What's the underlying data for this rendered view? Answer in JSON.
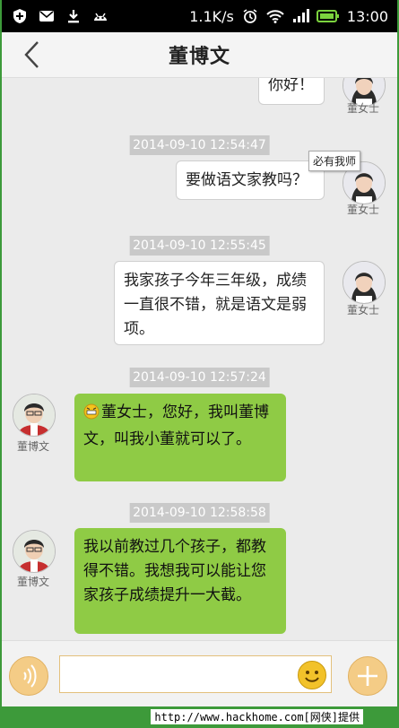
{
  "status_bar": {
    "speed": "1.1K/s",
    "time": "13:00"
  },
  "header": {
    "title": "董博文"
  },
  "messages": [
    {
      "side": "right",
      "text": "你好！",
      "name": "董女士"
    },
    {
      "side": "right",
      "timestamp": "2014-09-10 12:54:47",
      "text": "要做语文家教吗？",
      "name": "董女士"
    },
    {
      "side": "right",
      "timestamp": "2014-09-10 12:55:45",
      "text": "我家孩子今年三年级，成绩一直很不错，就是语文是弱项。",
      "name": "董女士"
    },
    {
      "side": "left",
      "timestamp": "2014-09-10 12:57:24",
      "text": "董女士，您好，我叫董博文，叫我小董就可以了。",
      "name": "董博文"
    },
    {
      "side": "left",
      "timestamp": "2014-09-10 12:58:58",
      "text": "我以前教过几个孩子，都教得不错。我想我可以能让您家孩子成绩提升一大截。",
      "name": "董博文"
    }
  ],
  "tooltip": "必有我师",
  "input": {
    "placeholder": ""
  },
  "watermark": "http://www.hackhome.com[网侠]提供",
  "colors": {
    "accent_green": "#8fcb45",
    "frame_green": "#3d9a3a",
    "button_orange": "#f4cc86"
  }
}
